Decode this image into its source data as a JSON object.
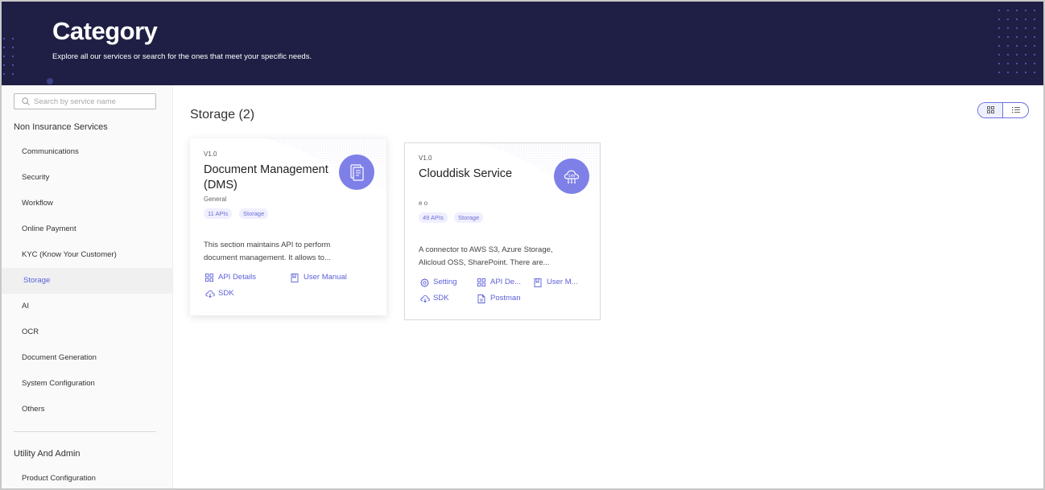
{
  "header": {
    "title": "Category",
    "subtitle": "Explore all our services or search for the ones that meet your specific needs."
  },
  "sidebar": {
    "search_placeholder": "Search by service name",
    "groups": [
      {
        "title": "Non Insurance Services",
        "items": [
          {
            "label": "Communications",
            "active": false
          },
          {
            "label": "Security",
            "active": false
          },
          {
            "label": "Workflow",
            "active": false
          },
          {
            "label": "Online Payment",
            "active": false
          },
          {
            "label": "KYC (Know Your Customer)",
            "active": false
          },
          {
            "label": "Storage",
            "active": true
          },
          {
            "label": "AI",
            "active": false
          },
          {
            "label": "OCR",
            "active": false
          },
          {
            "label": "Document Generation",
            "active": false
          },
          {
            "label": "System Configuration",
            "active": false
          },
          {
            "label": "Others",
            "active": false
          }
        ]
      },
      {
        "title": "Utility And Admin",
        "items": [
          {
            "label": "Product Configuration",
            "active": false
          }
        ]
      }
    ]
  },
  "main": {
    "section_title": "Storage (2)",
    "view_modes": [
      "grid-view-icon",
      "list-view-icon"
    ],
    "active_view": "grid",
    "cards": [
      {
        "version": "V1.0",
        "name": "Document Management (DMS)",
        "category": "General",
        "apis_badge": "11 APIs",
        "tag": "Storage",
        "description": "This section maintains API to perform document management. It allows to...",
        "icon": "document-icon",
        "actions": [
          {
            "label": "API Details",
            "icon": "grid-icon"
          },
          {
            "label": "User Manual",
            "icon": "book-icon"
          },
          {
            "label": "SDK",
            "icon": "cloud-icon"
          }
        ]
      },
      {
        "version": "V1.0",
        "name": "Clouddisk Service",
        "category": "e o",
        "apis_badge": "49 APIs",
        "tag": "Storage",
        "description": "A connector to AWS S3, Azure Storage, Alicloud OSS, SharePoint. There are...",
        "icon": "cloud-storage-icon",
        "actions": [
          {
            "label": "Setting",
            "icon": "gear-icon"
          },
          {
            "label": "API De...",
            "icon": "grid-icon"
          },
          {
            "label": "User M...",
            "icon": "book-icon"
          },
          {
            "label": "SDK",
            "icon": "cloud-icon"
          },
          {
            "label": "Postman",
            "icon": "file-icon"
          }
        ]
      }
    ]
  },
  "colors": {
    "header_bg": "#1f1f45",
    "accent": "#5b5fd8",
    "icon_circle": "#7e80e8",
    "tag_bg": "#efefff"
  }
}
